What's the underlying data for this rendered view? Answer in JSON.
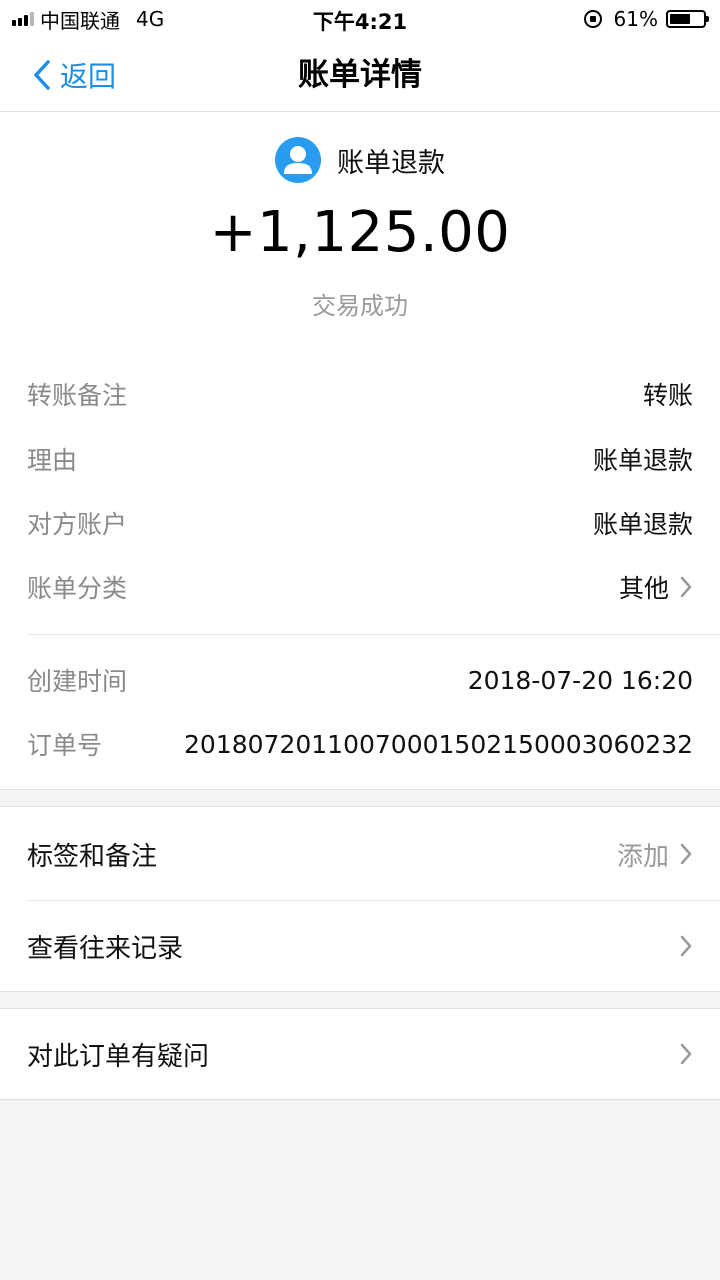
{
  "status_bar": {
    "carrier": "中国联通",
    "network": "4G",
    "time": "下午4:21",
    "battery": "61%",
    "battery_level": 0.61
  },
  "nav": {
    "back_label": "返回",
    "title": "账单详情"
  },
  "summary": {
    "payee": "账单退款",
    "amount": "+1,125.00",
    "status": "交易成功"
  },
  "details": [
    {
      "key": "转账备注",
      "value": "转账"
    },
    {
      "key": "理由",
      "value": "账单退款"
    },
    {
      "key": "对方账户",
      "value": "账单退款"
    },
    {
      "key": "账单分类",
      "value": "其他"
    },
    {
      "key": "创建时间",
      "value": "2018-07-20 16:20"
    },
    {
      "key": "订单号",
      "value": "2018072011007000150215000306023​2"
    }
  ],
  "menu": {
    "tags_label": "标签和备注",
    "tags_action": "添加",
    "history_label": "查看往来记录",
    "question_label": "对此订单有疑问"
  },
  "colors": {
    "accent": "#1a8ee8",
    "avatar": "#2a9cf0",
    "background": "#f4f4f6"
  }
}
